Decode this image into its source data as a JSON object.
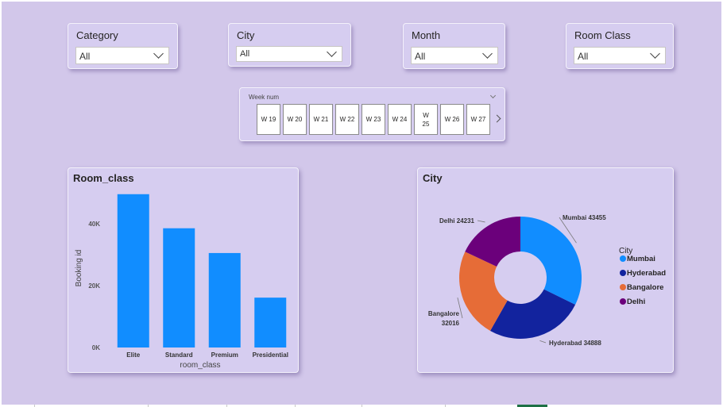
{
  "slicers": [
    {
      "title": "Category",
      "value": "All"
    },
    {
      "title": "City",
      "value": "All"
    },
    {
      "title": "Month",
      "value": "All"
    },
    {
      "title": "Room Class",
      "value": "All"
    }
  ],
  "week_slicer": {
    "title": "Week num",
    "weeks": [
      "W 19",
      "W 20",
      "W 21",
      "W 22",
      "W 23",
      "W 24",
      "W 25",
      "W 26",
      "W 27"
    ]
  },
  "colors": {
    "bar": "#118dff",
    "mumbai": "#118dff",
    "hyderabad": "#12239e",
    "bangalore": "#e66c37",
    "delhi": "#6b007b"
  },
  "chart_data": [
    {
      "type": "bar",
      "title": "Room_class",
      "xlabel": "room_class",
      "ylabel": "Booking id",
      "categories": [
        "Elite",
        "Standard",
        "Premium",
        "Presidential"
      ],
      "values": [
        49500,
        38500,
        30500,
        16100
      ],
      "ylim": [
        0,
        52000
      ],
      "yticks": [
        {
          "value": 0,
          "label": "0K"
        },
        {
          "value": 20000,
          "label": "20K"
        },
        {
          "value": 40000,
          "label": "40K"
        }
      ],
      "grid": false
    },
    {
      "type": "pie",
      "title": "City",
      "legend_title": "City",
      "legend_position": "right",
      "slices": [
        {
          "label": "Mumbai",
          "value": 43455,
          "label_text": "Mumbai 43455",
          "color": "#118dff"
        },
        {
          "label": "Hyderabad",
          "value": 34888,
          "label_text": "Hyderabad 34888",
          "color": "#12239e"
        },
        {
          "label": "Bangalore",
          "value": 32016,
          "label_text": "Bangalore 32016",
          "color": "#e66c37"
        },
        {
          "label": "Delhi",
          "value": 24231,
          "label_text": "Delhi 24231",
          "color": "#6b007b"
        }
      ]
    }
  ]
}
